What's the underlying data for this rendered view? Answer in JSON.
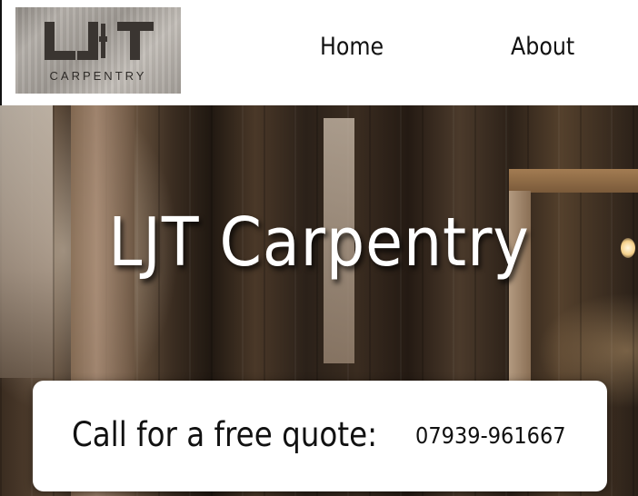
{
  "brand": {
    "logo_text": "CARPENTRY",
    "logo_mark": "LJT"
  },
  "nav": {
    "items": [
      {
        "label": "Home"
      },
      {
        "label": "About"
      }
    ]
  },
  "hero": {
    "title": "LJT Carpentry"
  },
  "cta": {
    "label": "Call for a free quote:",
    "phone": "07939-961667"
  },
  "colors": {
    "background": "#ffffff",
    "text": "#111111",
    "hero_title": "#ffffff"
  }
}
